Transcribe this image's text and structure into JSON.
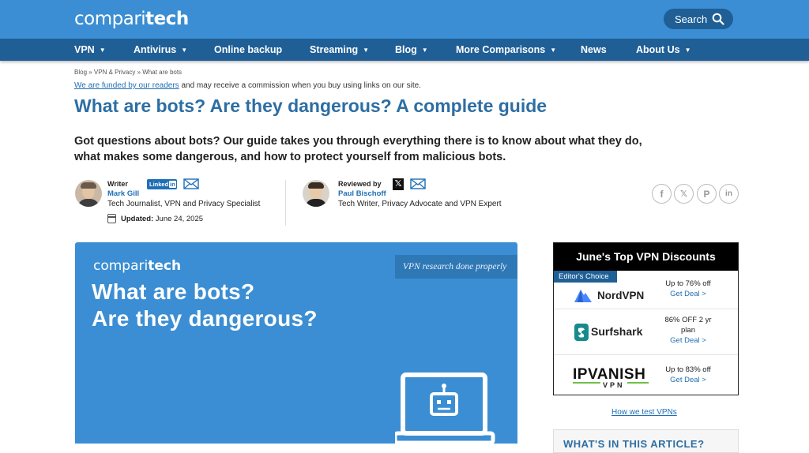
{
  "header": {
    "logo_light": "compari",
    "logo_bold": "tech",
    "search_label": "Search"
  },
  "nav": {
    "items": [
      {
        "label": "VPN",
        "dropdown": true
      },
      {
        "label": "Antivirus",
        "dropdown": true
      },
      {
        "label": "Online backup",
        "dropdown": false
      },
      {
        "label": "Streaming",
        "dropdown": true
      },
      {
        "label": "Blog",
        "dropdown": true
      },
      {
        "label": "More Comparisons",
        "dropdown": true
      },
      {
        "label": "News",
        "dropdown": false
      },
      {
        "label": "About Us",
        "dropdown": true
      }
    ]
  },
  "article": {
    "breadcrumb": "Blog » VPN & Privacy » What are bots",
    "funded_link": "We are funded by our readers",
    "funded_rest": " and may receive a commission when you buy using links on our site.",
    "title": "What are bots? Are they dangerous? A complete guide",
    "lede": "Got questions about bots? Our guide takes you through everything there is to know about what they do, what makes some dangerous, and how to protect yourself from malicious bots.",
    "writer": {
      "label": "Writer",
      "name": "Mark Gill",
      "role": "Tech Journalist, VPN and Privacy Specialist",
      "linkedin": "Linked",
      "linkedin_in": "in"
    },
    "reviewer": {
      "label": "Reviewed by",
      "name": "Paul Bischoff",
      "role": "Tech Writer, Privacy Advocate and VPN Expert",
      "x_glyph": "𝕏"
    },
    "updated_label": "Updated:",
    "updated_date": " June 24, 2025",
    "share": [
      {
        "name": "facebook",
        "glyph": "f"
      },
      {
        "name": "x",
        "glyph": "𝕏"
      },
      {
        "name": "pinterest",
        "glyph": "P"
      },
      {
        "name": "linkedin",
        "glyph": "in"
      }
    ]
  },
  "hero": {
    "logo_light": "compari",
    "logo_bold": "tech",
    "tagline": "VPN research done properly",
    "title_line1": "What are bots?",
    "title_line2": "Are they dangerous?"
  },
  "deals": {
    "heading": "June's Top VPN Discounts",
    "editor_badge": "Editor's Choice",
    "rows": [
      {
        "vendor": "NordVPN",
        "offer": "Up to 76% off",
        "cta": "Get Deal >"
      },
      {
        "vendor": "Surfshark",
        "offer": "86% OFF 2 yr plan",
        "cta": "Get Deal >"
      },
      {
        "vendor": "IPVANISH",
        "vendor_sub": "VPN",
        "offer": "Up to 83% off",
        "cta": "Get Deal >"
      }
    ],
    "how_we_test": "How we test VPNs"
  },
  "toc": {
    "title": "WHAT'S IN THIS ARTICLE?"
  },
  "colors": {
    "brand_blue": "#3b8ed3",
    "nav_blue": "#1f5f96",
    "link_blue": "#1f6fb5",
    "title_blue": "#2d6ea3"
  }
}
